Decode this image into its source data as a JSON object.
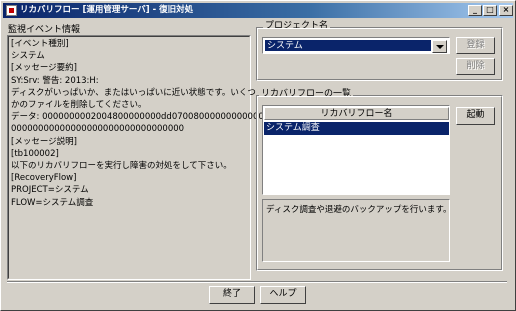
{
  "window": {
    "title": "リカバリフロー [運用管理サーバ] - 復旧対処"
  },
  "title_buttons": {
    "minimize": "_",
    "maximize": "□",
    "close": "×"
  },
  "monitor_event": {
    "label": "監視イベント情報",
    "lines": [
      "[イベント種別]",
      "システム",
      "[メッセージ要約]",
      "SY:Srv: 警告: 2013:H:",
      "ディスクがいっぱいか、またはいっぱいに近い状態です。いくつ",
      "かのファイルを削除してください。",
      "データ: 0000000002004800000000dd07008000000000000000000",
      "00000000000000000000000000000000",
      "[メッセージ説明]",
      "[tb100002]",
      "以下のリカバリフローを実行し障害の対処をして下さい。",
      "[RecoveryFlow]",
      "PROJECT=システム",
      "FLOW=システム調査"
    ]
  },
  "project": {
    "group_label": "プロジェクト名",
    "selected": "システム",
    "register_button": "登録",
    "delete_button": "削除"
  },
  "recovery_flows": {
    "group_label": "リカバリフローの一覧",
    "column_header": "リカバリフロー名",
    "items": [
      "システム調査"
    ],
    "start_button": "起動",
    "description": "ディスク調査や退避のバックアップを行います。"
  },
  "footer": {
    "end_button": "終了",
    "help_button": "ヘルプ"
  }
}
